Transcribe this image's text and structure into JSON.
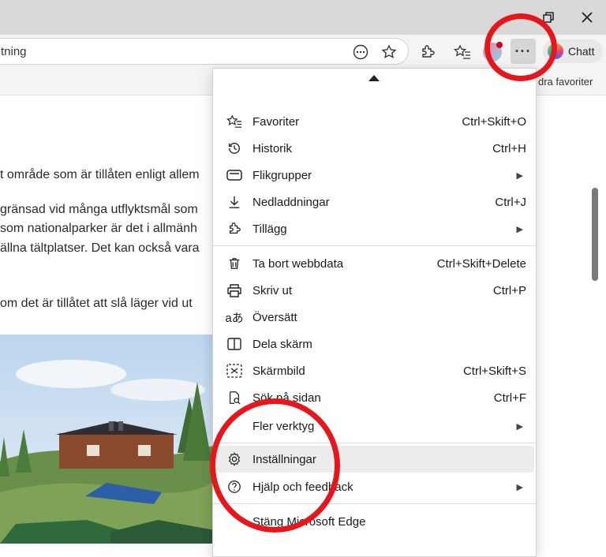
{
  "browser": {
    "address_text": "tning",
    "favorites_bar_text": "dra favoriter",
    "chat_label": "Chatt",
    "more_label": "···"
  },
  "page": {
    "lines": [
      "t område som är tillåten enligt allem",
      "gränsad vid många utflyktsmål som",
      "som nationalparker är det i allmänh",
      "ällna tältplatser. Det kan också vara",
      "om det är tillåtet att slå läger vid ut"
    ]
  },
  "menu": {
    "items": [
      {
        "label": "Favoriter",
        "shortcut": "Ctrl+Skift+O"
      },
      {
        "label": "Historik",
        "shortcut": "Ctrl+H"
      },
      {
        "label": "Flikgrupper",
        "shortcut": ""
      },
      {
        "label": "Nedladdningar",
        "shortcut": "Ctrl+J"
      },
      {
        "label": "Tillägg",
        "shortcut": ""
      },
      {
        "label": "Ta bort webbdata",
        "shortcut": "Ctrl+Skift+Delete"
      },
      {
        "label": "Skriv ut",
        "shortcut": "Ctrl+P"
      },
      {
        "label": "Översätt",
        "shortcut": ""
      },
      {
        "label": "Dela skärm",
        "shortcut": ""
      },
      {
        "label": "Skärmbild",
        "shortcut": "Ctrl+Skift+S"
      },
      {
        "label": "Sök på sidan",
        "shortcut": "Ctrl+F"
      },
      {
        "label": "Fler verktyg",
        "shortcut": ""
      },
      {
        "label": "Inställningar",
        "shortcut": ""
      },
      {
        "label": "Hjälp och feedback",
        "shortcut": ""
      },
      {
        "label": "Stäng Microsoft Edge",
        "shortcut": ""
      }
    ]
  },
  "colors": {
    "annotation_ring": "#e5171d",
    "highlight": "#ececec"
  }
}
